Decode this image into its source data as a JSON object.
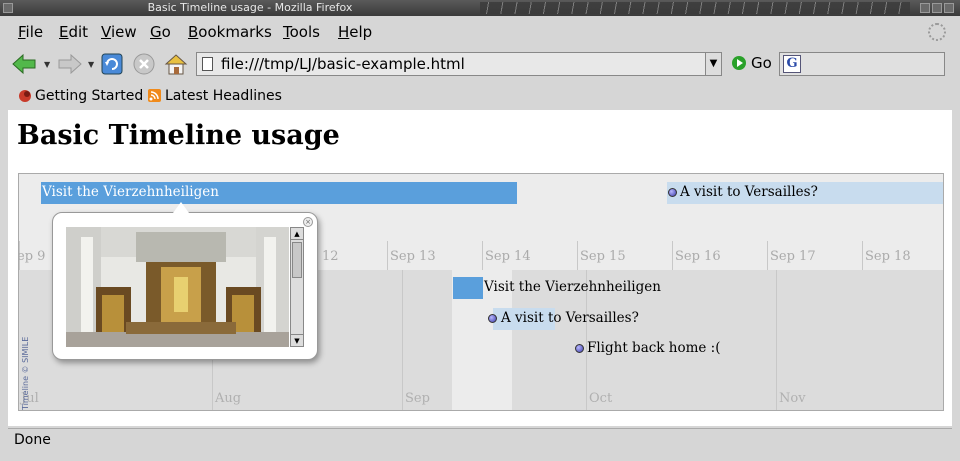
{
  "window": {
    "title": "Basic Timeline usage - Mozilla Firefox"
  },
  "menubar": {
    "items": [
      "File",
      "Edit",
      "View",
      "Go",
      "Bookmarks",
      "Tools",
      "Help"
    ]
  },
  "navbar": {
    "url": "file:///tmp/LJ/basic-example.html",
    "go_label": "Go"
  },
  "bookmarks": {
    "items": [
      "Getting Started",
      "Latest Headlines"
    ]
  },
  "page": {
    "title": "Basic Timeline usage"
  },
  "timeline": {
    "upper_ticks": [
      "ep 9",
      "12",
      "Sep 13",
      "Sep 14",
      "Sep 15",
      "Sep 16",
      "Sep 17",
      "Sep 18"
    ],
    "lower_ticks": [
      "Jul",
      "Aug",
      "Sep",
      "Oct",
      "Nov"
    ],
    "upper_events": [
      "Visit the Vierzehnheiligen",
      "A visit to Versailles?"
    ],
    "lower_events": [
      "Visit the Vierzehnheiligen",
      "A visit to Versailles?",
      "Flight back home :("
    ],
    "credit": "Timeline © SIMILE",
    "colors": {
      "duration_bar": "#5a9fdc",
      "tentative": "#c8dcee",
      "dot": "#5050c0"
    }
  },
  "status": {
    "text": "Done"
  }
}
